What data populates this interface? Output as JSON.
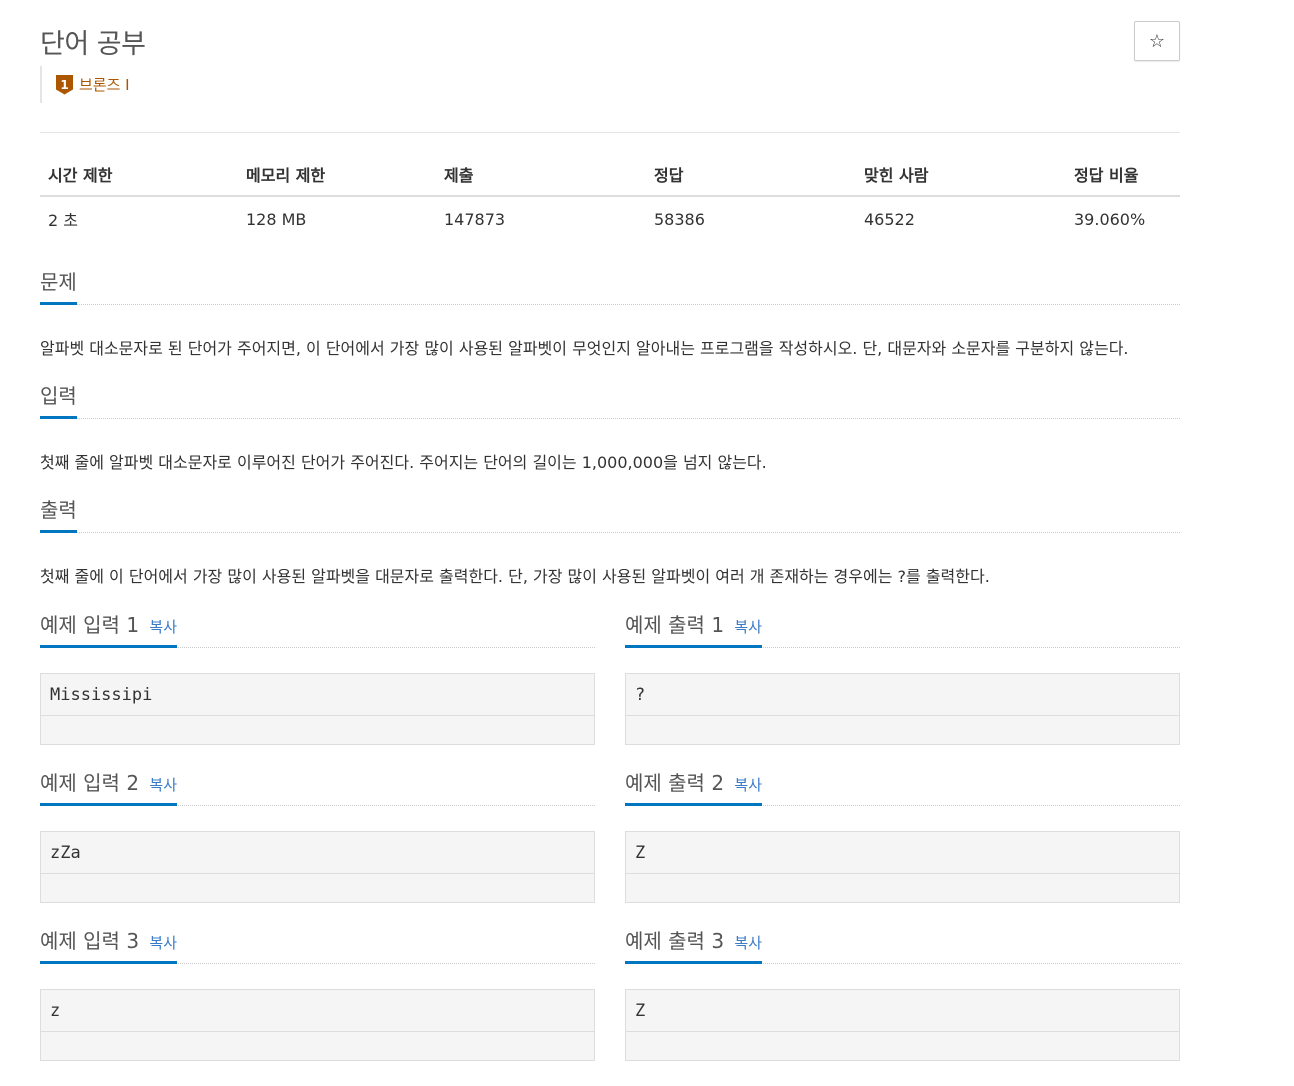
{
  "problem": {
    "title": "단어 공부",
    "star_icon": "☆"
  },
  "tier": {
    "badge": "1",
    "label": "브론즈 I"
  },
  "stats": {
    "headers": [
      "시간 제한",
      "메모리 제한",
      "제출",
      "정답",
      "맞힌 사람",
      "정답 비율"
    ],
    "values": [
      "2 초",
      "128 MB",
      "147873",
      "58386",
      "46522",
      "39.060%"
    ]
  },
  "sections": {
    "description": {
      "heading": "문제",
      "text": "알파벳 대소문자로 된 단어가 주어지면, 이 단어에서 가장 많이 사용된 알파벳이 무엇인지 알아내는 프로그램을 작성하시오. 단, 대문자와 소문자를 구분하지 않는다."
    },
    "input": {
      "heading": "입력",
      "text": "첫째 줄에 알파벳 대소문자로 이루어진 단어가 주어진다. 주어지는 단어의 길이는 1,000,000을 넘지 않는다."
    },
    "output": {
      "heading": "출력",
      "text": "첫째 줄에 이 단어에서 가장 많이 사용된 알파벳을 대문자로 출력한다. 단, 가장 많이 사용된 알파벳이 여러 개 존재하는 경우에는 ?를 출력한다."
    }
  },
  "samples": [
    {
      "input_heading": "예제 입력 1",
      "output_heading": "예제 출력 1",
      "copy": "복사",
      "input": "Mississipi",
      "output": "?"
    },
    {
      "input_heading": "예제 입력 2",
      "output_heading": "예제 출력 2",
      "copy": "복사",
      "input": "zZa",
      "output": "Z"
    },
    {
      "input_heading": "예제 입력 3",
      "output_heading": "예제 출력 3",
      "copy": "복사",
      "input": "z",
      "output": "Z"
    }
  ]
}
